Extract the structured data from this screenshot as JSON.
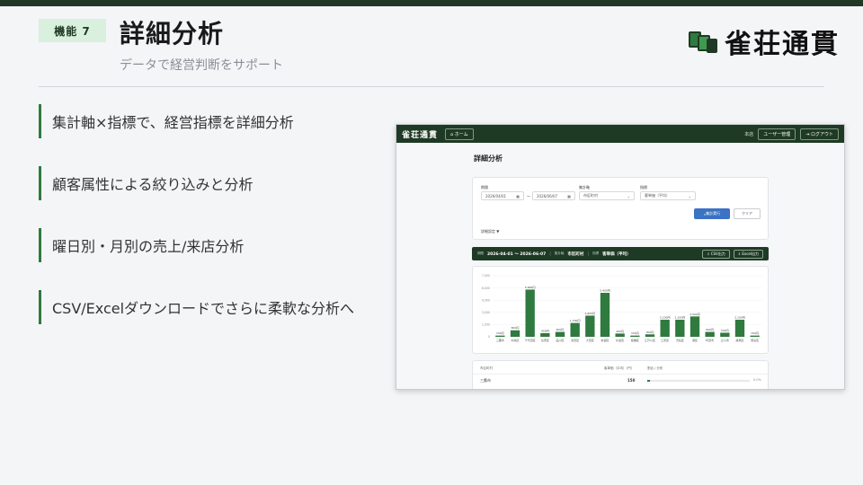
{
  "slide": {
    "badge": "機能 7",
    "title": "詳細分析",
    "subtitle": "データで経営判断をサポート",
    "logo_text": "雀荘通貫",
    "features": [
      "集計軸×指標で、経営指標を詳細分析",
      "顧客属性による絞り込みと分析",
      "曜日別・月別の売上/来店分析",
      "CSV/Excelダウンロードでさらに柔軟な分析へ"
    ]
  },
  "app": {
    "logo": "雀荘通貫",
    "home_button": "ホーム",
    "store_label": "本店",
    "user_button": "ユーザー管理",
    "logout_button": "ログアウト",
    "page_title": "詳細分析",
    "filters": {
      "period_label": "期間",
      "date_from": "2026/04/01",
      "date_sep": "〜",
      "date_to": "2026/06/07",
      "axis_label": "集計軸",
      "axis_value": "市区町村",
      "metric_label": "指標",
      "metric_value": "客単価（平均）",
      "run_button": "集計実行",
      "clear_button": "クリア",
      "advanced": "詳細設定 ▼"
    },
    "summary": {
      "period_key": "期間",
      "period_value": "2026-04-01 〜 2026-06-07",
      "axis_key": "集計軸",
      "axis_value": "市区町村",
      "metric_key": "指標",
      "metric_value": "客単価（平均）",
      "csv_button": "CSV出力",
      "excel_button": "Excel出力"
    },
    "table": {
      "col1": "市区町村",
      "col2": "客単価（平均）（円）",
      "col3": "割合 / 分布",
      "row_name": "三鷹市",
      "row_value": "150",
      "row_pct": "0.0%"
    }
  },
  "chart_data": {
    "type": "bar",
    "categories": [
      "三鷹市",
      "中央区",
      "千代田区",
      "台東区",
      "品川区",
      "墨田区",
      "大田区",
      "新宿区",
      "杉並区",
      "板橋区",
      "江戸川区",
      "江東区",
      "渋谷区",
      "港区",
      "町田市",
      "立川市",
      "練馬区",
      "豊島区"
    ],
    "values": [
      150,
      800,
      5800,
      450,
      600,
      1700,
      2600,
      5400,
      400,
      150,
      300,
      2100,
      2100,
      2500,
      600,
      500,
      2100,
      150
    ],
    "value_labels": [
      "150円",
      "800円",
      "5,800円",
      "450円",
      "600円",
      "1,700円",
      "2,600円",
      "5,400円",
      "400円",
      "150円",
      "300円",
      "2,100円",
      "2,100円",
      "2,500円",
      "600円",
      "500円",
      "2,100円",
      "150円"
    ],
    "yticks": [
      "0",
      "1,500",
      "3,000",
      "4,500",
      "6,000",
      "7,500"
    ],
    "ylim": [
      0,
      7500
    ],
    "grid": true
  }
}
